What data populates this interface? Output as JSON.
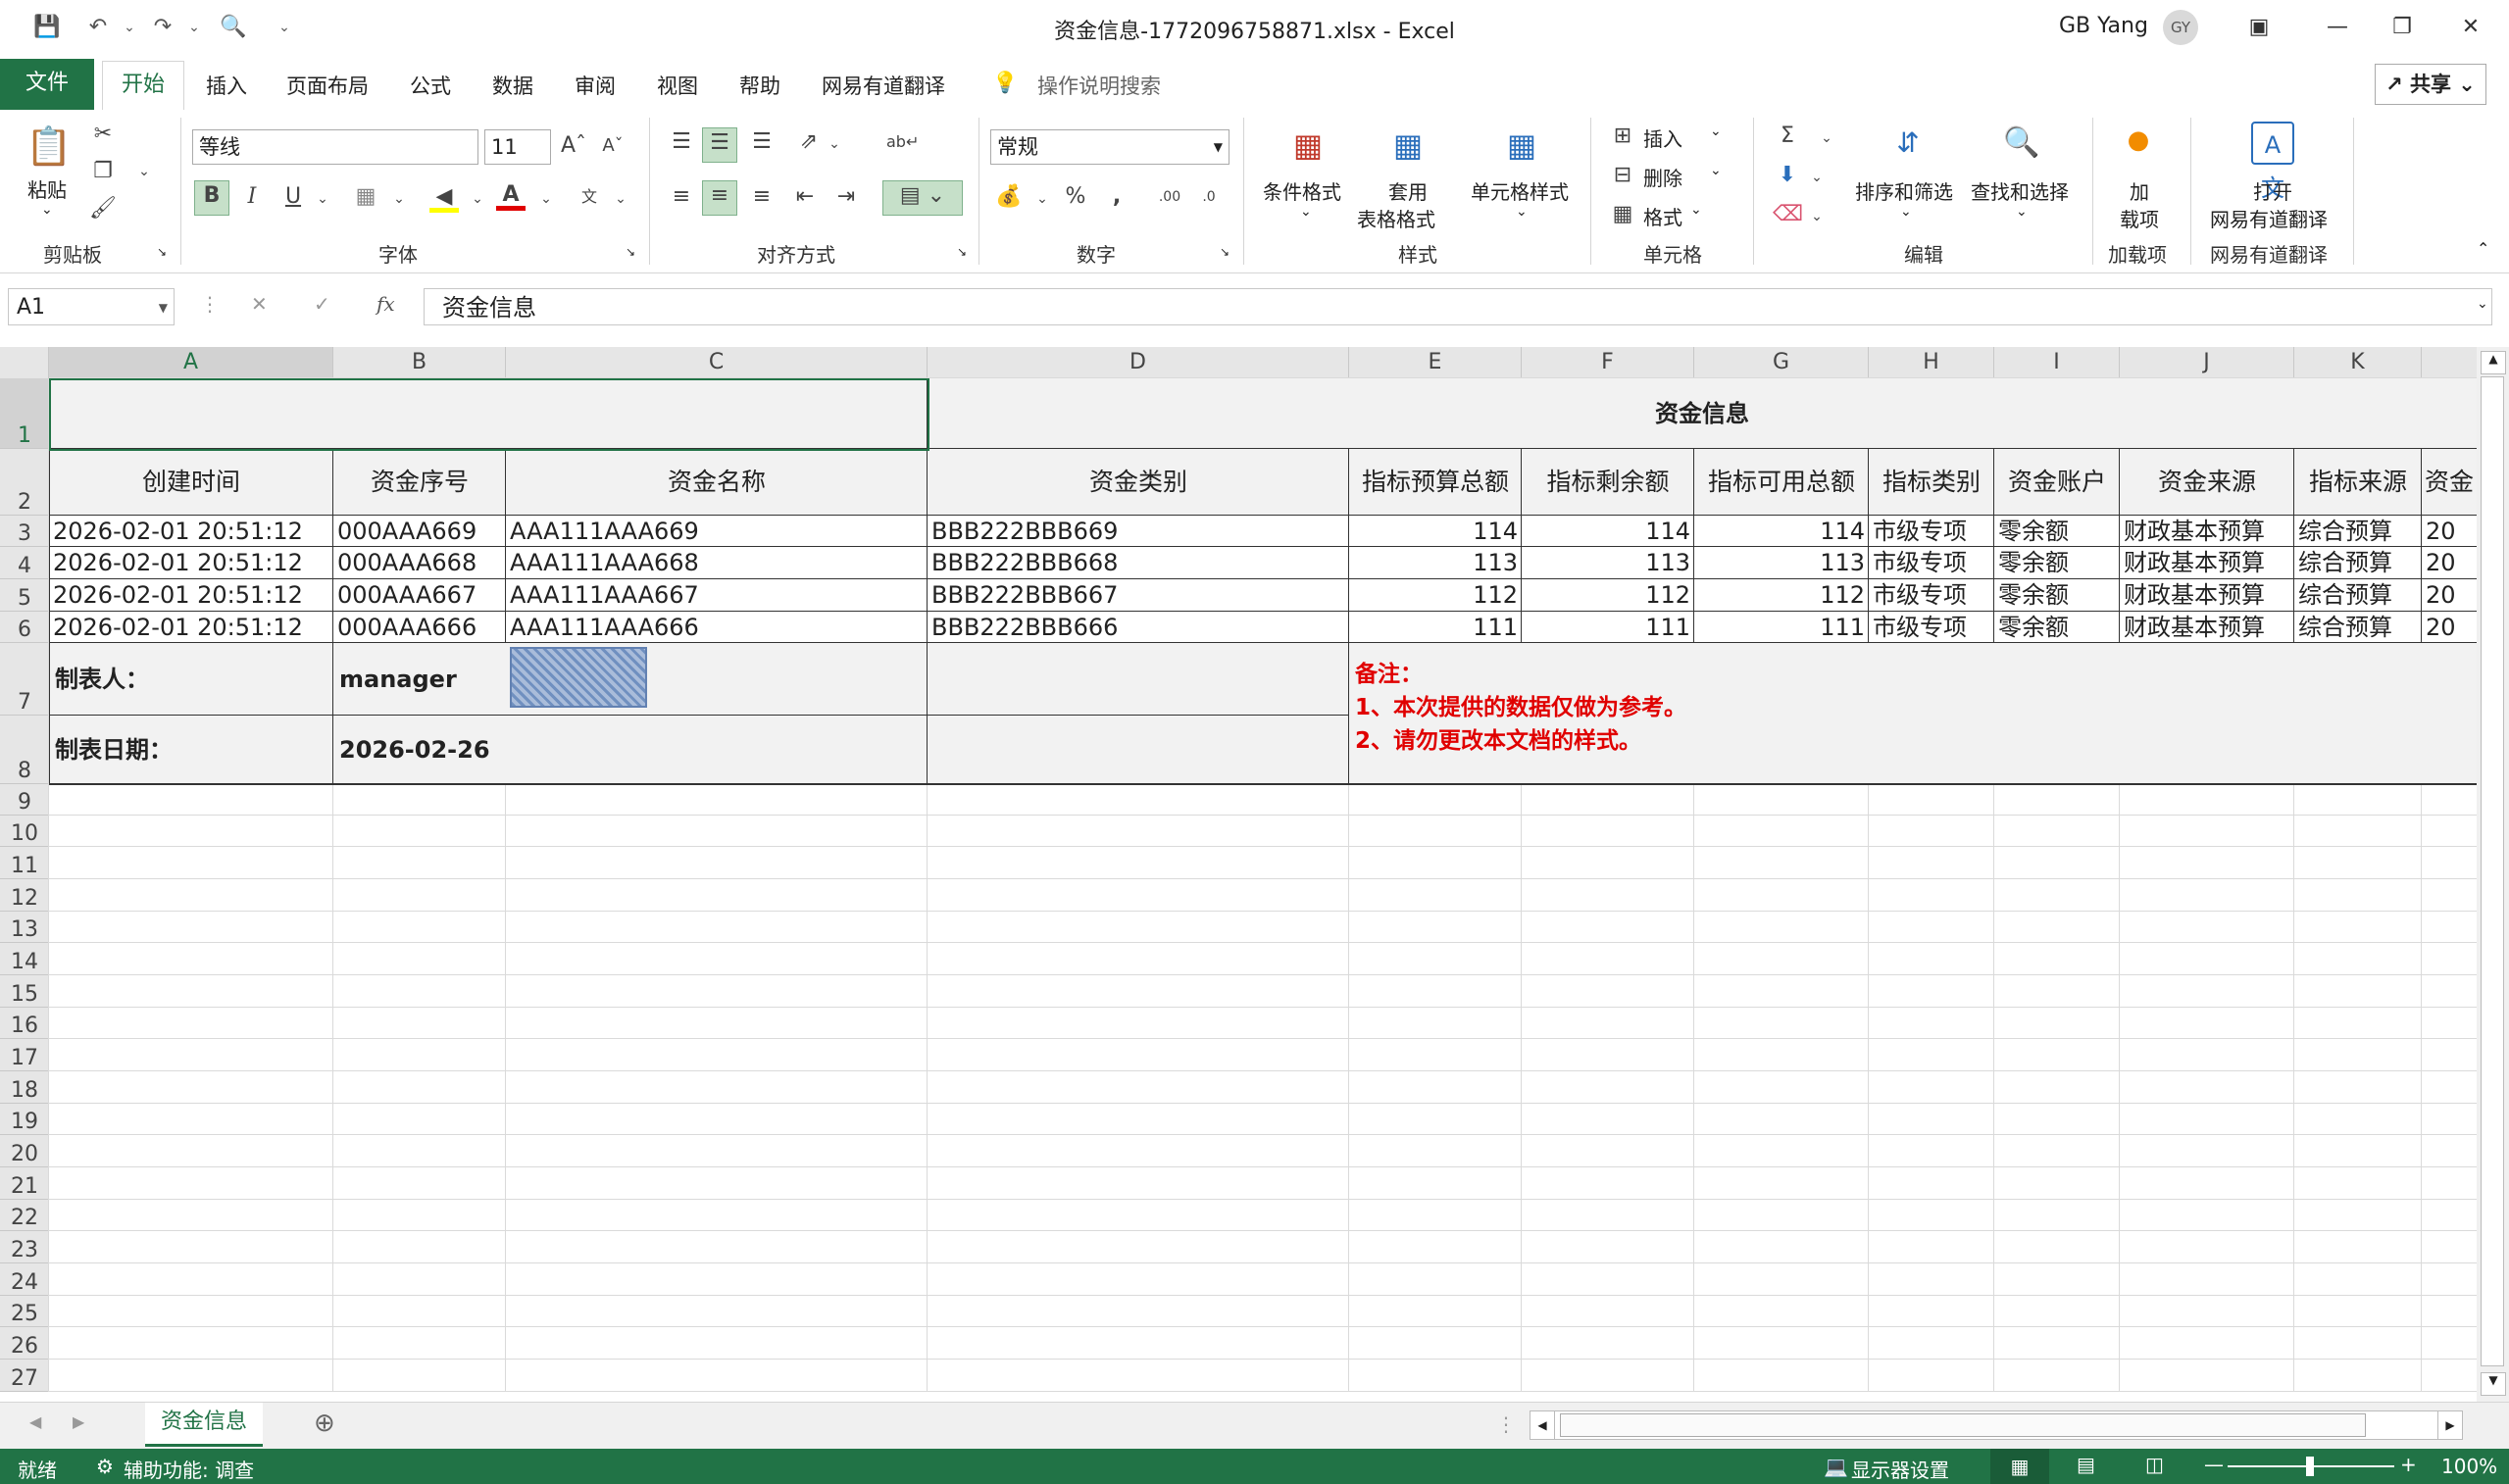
{
  "window": {
    "title": "资金信息-1772096758871.xlsx  -  Excel",
    "user_name": "GB Yang",
    "user_initials": "GY"
  },
  "tabs": [
    "文件",
    "开始",
    "插入",
    "页面布局",
    "公式",
    "数据",
    "审阅",
    "视图",
    "帮助",
    "网易有道翻译"
  ],
  "tell_me": "操作说明搜索",
  "share_label": "共享",
  "ribbon": {
    "paste_label": "粘贴",
    "clipboard_label": "剪贴板",
    "font_name": "等线",
    "font_size": "11",
    "font_group_label": "字体",
    "bold": "B",
    "italic": "I",
    "underline": "U",
    "align_group_label": "对齐方式",
    "number_format": "常规",
    "number_group_label": "数字",
    "cond_format": "条件格式",
    "table_format_1": "套用",
    "table_format_2": "表格格式",
    "cell_style": "单元格样式",
    "style_group_label": "样式",
    "insert_label": "插入",
    "delete_label": "删除",
    "format_label": "格式",
    "cells_group_label": "单元格",
    "sort_filter": "排序和筛选",
    "find_select": "查找和选择",
    "edit_group_label": "编辑",
    "addin_1": "加",
    "addin_2": "载项",
    "addin_group_label": "加载项",
    "youdao_1": "打开",
    "youdao_2": "网易有道翻译",
    "youdao_group_label": "网易有道翻译"
  },
  "formula_bar": {
    "name_box": "A1",
    "fx": "fx",
    "content": "资金信息"
  },
  "columns": [
    "A",
    "B",
    "C",
    "D",
    "E",
    "F",
    "G",
    "H",
    "I",
    "J",
    "K"
  ],
  "rows": [
    "1",
    "2",
    "3",
    "4",
    "5",
    "6",
    "7",
    "8",
    "9",
    "10",
    "11",
    "12",
    "13",
    "14",
    "15",
    "16",
    "17",
    "18",
    "19",
    "20",
    "21",
    "22",
    "23",
    "24",
    "25",
    "26",
    "27"
  ],
  "sheet": {
    "title": "资金信息",
    "headers": [
      "创建时间",
      "资金序号",
      "资金名称",
      "资金类别",
      "指标预算总额",
      "指标剩余额",
      "指标可用总额",
      "指标类别",
      "资金账户",
      "资金来源",
      "指标来源",
      "资金"
    ],
    "data_rows": [
      [
        "2026-02-01 20:51:12",
        "000AAA669",
        "AAA111AAA669",
        "BBB222BBB669",
        "114",
        "114",
        "114",
        "市级专项",
        "零余额",
        "财政基本预算",
        "综合预算",
        "20"
      ],
      [
        "2026-02-01 20:51:12",
        "000AAA668",
        "AAA111AAA668",
        "BBB222BBB668",
        "113",
        "113",
        "113",
        "市级专项",
        "零余额",
        "财政基本预算",
        "综合预算",
        "20"
      ],
      [
        "2026-02-01 20:51:12",
        "000AAA667",
        "AAA111AAA667",
        "BBB222BBB667",
        "112",
        "112",
        "112",
        "市级专项",
        "零余额",
        "财政基本预算",
        "综合预算",
        "20"
      ],
      [
        "2026-02-01 20:51:12",
        "000AAA666",
        "AAA111AAA666",
        "BBB222BBB666",
        "111",
        "111",
        "111",
        "市级专项",
        "零余额",
        "财政基本预算",
        "综合预算",
        "20"
      ]
    ],
    "maker_label": "制表人：",
    "maker_value": "manager",
    "date_label": "制表日期：",
    "date_value": "2026-02-26",
    "note_title": "备注：",
    "note_1": "1、本次提供的数据仅做为参考。",
    "note_2": "2、请勿更改本文档的样式。",
    "note_color": "#e00000"
  },
  "sheet_tab": "资金信息",
  "status": {
    "ready": "就绪",
    "accessibility": "辅助功能: 调查",
    "display_settings": "显示器设置",
    "zoom": "100%"
  },
  "accent_color": "#217346"
}
